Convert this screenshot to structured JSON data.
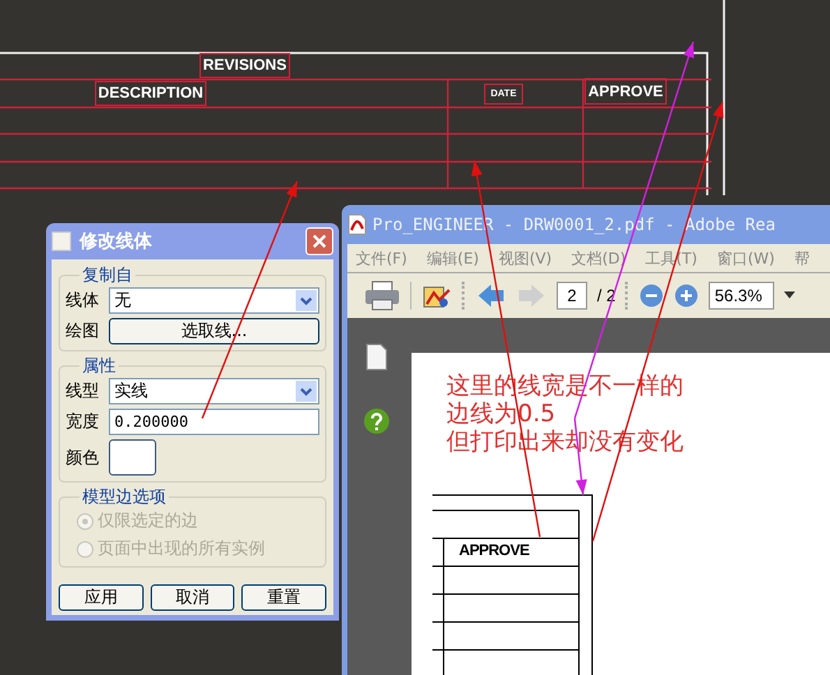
{
  "cad_drawing": {
    "labels": [
      {
        "text": "REVISIONS",
        "kind": "heading"
      },
      {
        "text": "DESCRIPTION",
        "kind": "column"
      },
      {
        "text": "DATE",
        "kind": "small"
      },
      {
        "text": "APPROVE",
        "kind": "column"
      }
    ]
  },
  "dialog": {
    "title": "修改线体",
    "groups": [
      {
        "title": "复制自",
        "disabled": false,
        "rows": [
          {
            "kind": "dropdown",
            "label": "线体",
            "value": "无"
          },
          {
            "kind": "button",
            "label": "绘图",
            "value": "选取线..."
          }
        ]
      },
      {
        "title": "属性",
        "disabled": false,
        "rows": [
          {
            "kind": "dropdown",
            "label": "线型",
            "value": "实线"
          },
          {
            "kind": "input",
            "label": "宽度",
            "value": "0.200000"
          },
          {
            "kind": "color",
            "label": "颜色"
          }
        ]
      },
      {
        "title": "模型边选项",
        "disabled": true,
        "rows": [
          {
            "kind": "radio",
            "label": "仅限选定的边",
            "selected": true
          },
          {
            "kind": "radio",
            "label": "页面中出现的所有实例",
            "selected": false
          }
        ]
      }
    ],
    "buttons": [
      "应用",
      "取消",
      "重置"
    ]
  },
  "pdf_window": {
    "title": "Pro_ENGINEER - DRW0001_2.pdf - Adobe Rea",
    "menu": [
      "文件(F)",
      "编辑(E)",
      "视图(V)",
      "文档(D)",
      "工具(T)",
      "窗口(W)",
      "帮"
    ],
    "page": "2",
    "page_total": "/ 2",
    "zoom": "56.3%",
    "note": [
      "这里的线宽是不一样的",
      "边线为0.5",
      "但打印出来却没有变化"
    ],
    "page_label": "APPROVE"
  }
}
